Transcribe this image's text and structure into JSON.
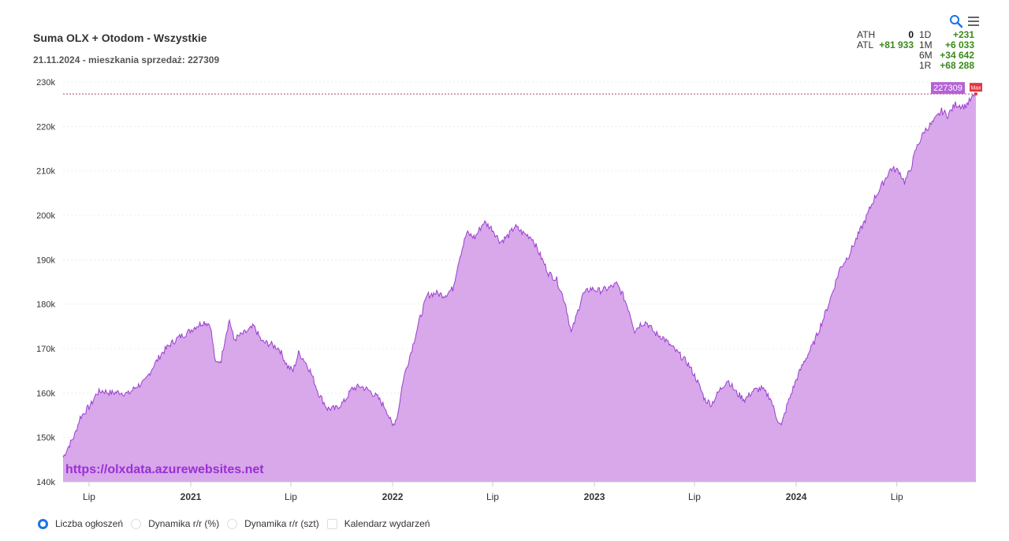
{
  "header": {
    "title": "Suma OLX + Otodom - Wszystkie",
    "subtitle": "21.11.2024 - mieszkania sprzedaż: 227309",
    "icons": [
      "zoom-icon",
      "menu-icon"
    ]
  },
  "stats": {
    "ath_label": "ATH",
    "ath_value": "0",
    "atl_label": "ATL",
    "atl_value": "+81 933",
    "d1_label": "1D",
    "d1_value": "+231",
    "m1_label": "1M",
    "m1_value": "+6 033",
    "m6_label": "6M",
    "m6_value": "+34 642",
    "r1_label": "1R",
    "r1_value": "+68 288"
  },
  "watermark": "https://olxdata.azurewebsites.net",
  "legend": {
    "items": [
      "Liczba ogłoszeń",
      "Dynamika r/r (%)",
      "Dynamika r/r (szt)",
      "Kalendarz wydarzeń"
    ]
  },
  "colors": {
    "fill": "#d8a8ea",
    "line": "#9b3fd0",
    "max_line": "#b0417a",
    "max_badge": "#e3343f",
    "value_badge": "#b561d6",
    "positive": "#3a8a1a"
  },
  "chart_data": {
    "type": "area",
    "title": "Suma OLX + Otodom - Wszystkie",
    "subtitle": "21.11.2024 - mieszkania sprzedaż: 227309",
    "y_ticks": [
      "140k",
      "150k",
      "160k",
      "170k",
      "180k",
      "190k",
      "200k",
      "210k",
      "220k",
      "230k"
    ],
    "ylim": [
      140000,
      230000
    ],
    "x_ticks": [
      {
        "date": "2020-07-01",
        "label": "Lip",
        "bold": false
      },
      {
        "date": "2021-01-01",
        "label": "2021",
        "bold": true
      },
      {
        "date": "2021-07-01",
        "label": "Lip",
        "bold": false
      },
      {
        "date": "2022-01-01",
        "label": "2022",
        "bold": true
      },
      {
        "date": "2022-07-01",
        "label": "Lip",
        "bold": false
      },
      {
        "date": "2023-01-01",
        "label": "2023",
        "bold": true
      },
      {
        "date": "2023-07-01",
        "label": "Lip",
        "bold": false
      },
      {
        "date": "2024-01-01",
        "label": "2024",
        "bold": true
      },
      {
        "date": "2024-07-01",
        "label": "Lip",
        "bold": false
      }
    ],
    "xlim": [
      "2020-05-15",
      "2024-11-21"
    ],
    "last_value": "227309",
    "max_label": "Max",
    "series": [
      {
        "points": [
          [
            "2020-05-15",
            145500
          ],
          [
            "2020-05-25",
            148000
          ],
          [
            "2020-06-05",
            150500
          ],
          [
            "2020-06-15",
            154500
          ],
          [
            "2020-06-25",
            156000
          ],
          [
            "2020-07-05",
            157500
          ],
          [
            "2020-07-15",
            160000
          ],
          [
            "2020-07-25",
            160500
          ],
          [
            "2020-08-10",
            160000
          ],
          [
            "2020-08-25",
            160200
          ],
          [
            "2020-09-10",
            159800
          ],
          [
            "2020-09-25",
            161500
          ],
          [
            "2020-10-10",
            162500
          ],
          [
            "2020-10-25",
            166000
          ],
          [
            "2020-11-10",
            169000
          ],
          [
            "2020-11-25",
            171000
          ],
          [
            "2020-12-10",
            172500
          ],
          [
            "2020-12-25",
            173500
          ],
          [
            "2021-01-10",
            175000
          ],
          [
            "2021-01-25",
            176000
          ],
          [
            "2021-02-05",
            175500
          ],
          [
            "2021-02-15",
            166500
          ],
          [
            "2021-02-25",
            167500
          ],
          [
            "2021-03-05",
            173000
          ],
          [
            "2021-03-12",
            176500
          ],
          [
            "2021-03-20",
            172000
          ],
          [
            "2021-04-01",
            173000
          ],
          [
            "2021-04-15",
            174000
          ],
          [
            "2021-04-25",
            175000
          ],
          [
            "2021-05-10",
            171500
          ],
          [
            "2021-05-25",
            171000
          ],
          [
            "2021-06-10",
            170000
          ],
          [
            "2021-06-25",
            166000
          ],
          [
            "2021-07-05",
            165000
          ],
          [
            "2021-07-15",
            169000
          ],
          [
            "2021-07-25",
            167500
          ],
          [
            "2021-08-05",
            165000
          ],
          [
            "2021-08-20",
            160000
          ],
          [
            "2021-09-05",
            156500
          ],
          [
            "2021-09-20",
            156500
          ],
          [
            "2021-10-05",
            158000
          ],
          [
            "2021-10-20",
            161000
          ],
          [
            "2021-11-05",
            161500
          ],
          [
            "2021-11-20",
            160500
          ],
          [
            "2021-12-05",
            159000
          ],
          [
            "2021-12-20",
            156500
          ],
          [
            "2022-01-01",
            152500
          ],
          [
            "2022-01-10",
            155000
          ],
          [
            "2022-01-20",
            163000
          ],
          [
            "2022-02-05",
            170000
          ],
          [
            "2022-02-20",
            177000
          ],
          [
            "2022-03-05",
            182000
          ],
          [
            "2022-03-20",
            182500
          ],
          [
            "2022-04-05",
            182000
          ],
          [
            "2022-04-20",
            183500
          ],
          [
            "2022-05-01",
            190000
          ],
          [
            "2022-05-15",
            196000
          ],
          [
            "2022-05-30",
            195000
          ],
          [
            "2022-06-15",
            198500
          ],
          [
            "2022-06-30",
            197000
          ],
          [
            "2022-07-15",
            194000
          ],
          [
            "2022-07-30",
            195500
          ],
          [
            "2022-08-10",
            197500
          ],
          [
            "2022-08-25",
            196000
          ],
          [
            "2022-09-10",
            195000
          ],
          [
            "2022-09-25",
            191000
          ],
          [
            "2022-10-10",
            187000
          ],
          [
            "2022-10-25",
            185500
          ],
          [
            "2022-11-10",
            180000
          ],
          [
            "2022-11-20",
            173500
          ],
          [
            "2022-11-30",
            177500
          ],
          [
            "2022-12-10",
            182000
          ],
          [
            "2022-12-25",
            183500
          ],
          [
            "2023-01-10",
            183000
          ],
          [
            "2023-01-25",
            183500
          ],
          [
            "2023-02-10",
            184500
          ],
          [
            "2023-02-20",
            182500
          ],
          [
            "2023-03-05",
            178500
          ],
          [
            "2023-03-15",
            174000
          ],
          [
            "2023-03-25",
            175500
          ],
          [
            "2023-04-05",
            176000
          ],
          [
            "2023-04-20",
            173500
          ],
          [
            "2023-05-05",
            172500
          ],
          [
            "2023-05-20",
            170500
          ],
          [
            "2023-06-05",
            168500
          ],
          [
            "2023-06-20",
            166500
          ],
          [
            "2023-07-05",
            163000
          ],
          [
            "2023-07-20",
            158500
          ],
          [
            "2023-08-01",
            157500
          ],
          [
            "2023-08-15",
            160500
          ],
          [
            "2023-08-30",
            163000
          ],
          [
            "2023-09-15",
            160000
          ],
          [
            "2023-09-30",
            158500
          ],
          [
            "2023-10-15",
            160500
          ],
          [
            "2023-10-30",
            161000
          ],
          [
            "2023-11-15",
            159000
          ],
          [
            "2023-11-25",
            155000
          ],
          [
            "2023-12-05",
            152500
          ],
          [
            "2023-12-15",
            157000
          ],
          [
            "2024-01-01",
            163000
          ],
          [
            "2024-01-15",
            167000
          ],
          [
            "2024-02-01",
            171000
          ],
          [
            "2024-02-20",
            177000
          ],
          [
            "2024-03-05",
            182000
          ],
          [
            "2024-03-20",
            188000
          ],
          [
            "2024-04-05",
            191000
          ],
          [
            "2024-04-20",
            195000
          ],
          [
            "2024-05-05",
            199000
          ],
          [
            "2024-05-20",
            203500
          ],
          [
            "2024-06-05",
            207000
          ],
          [
            "2024-06-20",
            210500
          ],
          [
            "2024-07-05",
            210000
          ],
          [
            "2024-07-15",
            207500
          ],
          [
            "2024-07-25",
            210000
          ],
          [
            "2024-08-05",
            215000
          ],
          [
            "2024-08-20",
            219000
          ],
          [
            "2024-09-05",
            221000
          ],
          [
            "2024-09-20",
            223500
          ],
          [
            "2024-10-01",
            222500
          ],
          [
            "2024-10-15",
            225000
          ],
          [
            "2024-11-01",
            224500
          ],
          [
            "2024-11-15",
            226500
          ],
          [
            "2024-11-21",
            227309
          ]
        ]
      }
    ]
  }
}
